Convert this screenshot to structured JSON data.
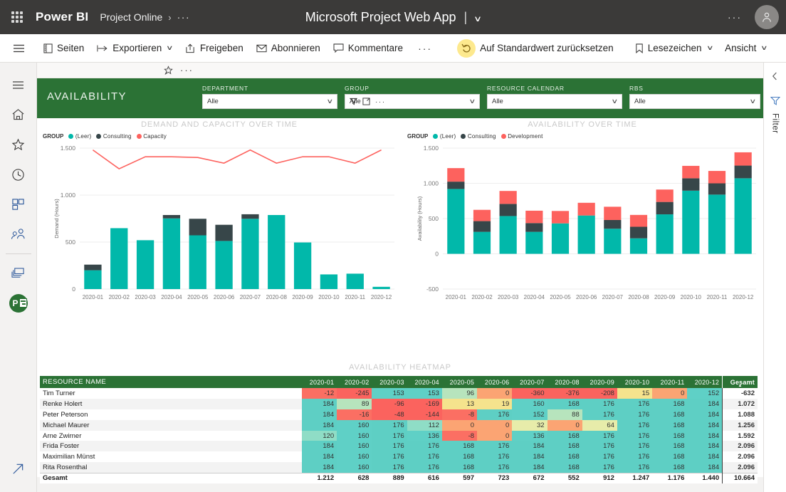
{
  "topbar": {
    "waffle_icon": "app-launcher-icon",
    "brand": "Power BI",
    "breadcrumb": "Project Online",
    "breadcrumb_sep": "›",
    "breadcrumb_more": "···",
    "app_title": "Microsoft Project Web App",
    "title_sep": "|",
    "title_caret": "∨",
    "more_options": "···",
    "avatar_icon": "user-avatar-icon"
  },
  "commandbar": {
    "menu_icon": "hamburger-menu-icon",
    "items": [
      {
        "label": "Seiten",
        "icon": "pages-icon",
        "caret": ""
      },
      {
        "label": "Exportieren",
        "icon": "export-icon",
        "caret": "∨"
      },
      {
        "label": "Freigeben",
        "icon": "share-icon",
        "caret": ""
      },
      {
        "label": "Abonnieren",
        "icon": "subscribe-mail-icon",
        "caret": ""
      },
      {
        "label": "Kommentare",
        "icon": "comments-icon",
        "caret": ""
      }
    ],
    "overflow": "···",
    "reset_label": "Auf Standardwert zurücksetzen",
    "reset_icon": "reset-undo-icon",
    "bookmarks_label": "Lesezeichen",
    "bookmarks_icon": "bookmark-icon",
    "bookmarks_caret": "∨",
    "view_label": "Ansicht",
    "view_caret": "∨"
  },
  "rail": {
    "items": [
      {
        "name": "nav-toggle",
        "icon": "hamburger-menu-icon"
      },
      {
        "name": "home",
        "icon": "home-icon"
      },
      {
        "name": "favorites",
        "icon": "star-icon"
      },
      {
        "name": "recent",
        "icon": "clock-icon"
      },
      {
        "name": "apps",
        "icon": "apps-grid-icon"
      },
      {
        "name": "shared-with-me",
        "icon": "people-icon"
      },
      {
        "name": "workspaces",
        "icon": "layers-icon"
      },
      {
        "name": "project-online-workspace",
        "icon": "project-app-icon"
      }
    ],
    "bottom": {
      "name": "get-data",
      "icon": "arrow-up-right-icon"
    }
  },
  "pagebar": {
    "pin_icon": "pin-star-icon",
    "more_icon": "···"
  },
  "report": {
    "banner_title": "AVAILABILITY",
    "slicers": [
      {
        "label": "DEPARTMENT",
        "value": "Alle",
        "caret": "∨"
      },
      {
        "label": "GROUP",
        "value": "Alle",
        "caret": "∨",
        "hover": {
          "filter_icon": "filter-icon",
          "focus_icon": "focus-mode-icon",
          "more": "···"
        }
      },
      {
        "label": "RESOURCE CALENDAR",
        "value": "Alle",
        "caret": "∨"
      },
      {
        "label": "RBS",
        "value": "Alle",
        "caret": "∨"
      }
    ],
    "heatmap_title": "AVAILABILITY HEATMAP"
  },
  "colors": {
    "teal": "#01b8aa",
    "dark": "#374649",
    "red": "#fd625e",
    "green_header": "#2b7235",
    "topbar": "#3b3a39",
    "reset_highlight": "#fde98e"
  },
  "chart_data": [
    {
      "type": "bar",
      "id": "demand-and-capacity-over-time",
      "title": "DEMAND AND CAPACITY OVER TIME",
      "legend_title": "GROUP",
      "legend_position": "top-left",
      "xlabel": "",
      "ylabel": "Demand (Hours)",
      "ylim": [
        0,
        1500
      ],
      "yticks": [
        0,
        500,
        1000,
        1500
      ],
      "ytick_labels": [
        "0",
        "500",
        "1.000",
        "1.500"
      ],
      "grid": true,
      "categories": [
        "2020-01",
        "2020-02",
        "2020-03",
        "2020-04",
        "2020-05",
        "2020-06",
        "2020-07",
        "2020-08",
        "2020-09",
        "2020-10",
        "2020-11",
        "2020-12"
      ],
      "series": [
        {
          "name": "(Leer)",
          "color": "#01b8aa",
          "kind": "bar",
          "values": [
            200,
            648,
            520,
            752,
            572,
            512,
            748,
            788,
            496,
            156,
            164,
            24
          ]
        },
        {
          "name": "Consulting",
          "color": "#374649",
          "kind": "bar",
          "values": [
            60,
            0,
            0,
            36,
            176,
            172,
            48,
            0,
            0,
            0,
            0,
            0
          ]
        },
        {
          "name": "Capacity",
          "color": "#fd625e",
          "kind": "line",
          "values": [
            1480,
            1280,
            1408,
            1408,
            1400,
            1340,
            1480,
            1340,
            1408,
            1408,
            1340,
            1480
          ]
        }
      ]
    },
    {
      "type": "bar",
      "id": "availability-over-time",
      "title": "AVAILABILITY OVER TIME",
      "legend_title": "GROUP",
      "legend_position": "top-left",
      "xlabel": "",
      "ylabel": "Availability (Hours)",
      "ylim": [
        -500,
        1500
      ],
      "yticks": [
        -500,
        0,
        500,
        1000,
        1500
      ],
      "ytick_labels": [
        "-500",
        "0",
        "500",
        "1.000",
        "1.500"
      ],
      "grid": true,
      "categories": [
        "2020-01",
        "2020-02",
        "2020-03",
        "2020-04",
        "2020-05",
        "2020-06",
        "2020-07",
        "2020-08",
        "2020-09",
        "2020-10",
        "2020-11",
        "2020-12"
      ],
      "series": [
        {
          "name": "(Leer)",
          "color": "#01b8aa",
          "kind": "bar",
          "values": [
            920,
            312,
            536,
            312,
            432,
            544,
            356,
            220,
            560,
            896,
            840,
            1072
          ]
        },
        {
          "name": "Consulting",
          "color": "#374649",
          "kind": "bar",
          "values": [
            104,
            152,
            172,
            124,
            0,
            0,
            124,
            164,
            176,
            176,
            160,
            180
          ]
        },
        {
          "name": "Development",
          "color": "#fd625e",
          "kind": "bar",
          "values": [
            192,
            160,
            184,
            176,
            176,
            180,
            188,
            168,
            176,
            176,
            176,
            188
          ]
        }
      ]
    },
    {
      "type": "table",
      "id": "availability-heatmap",
      "title": "AVAILABILITY HEATMAP",
      "columns": [
        "RESOURCE NAME",
        "2020-01",
        "2020-02",
        "2020-03",
        "2020-04",
        "2020-05",
        "2020-06",
        "2020-07",
        "2020-08",
        "2020-09",
        "2020-10",
        "2020-11",
        "2020-12",
        "Gesamt"
      ],
      "rows": [
        {
          "name": "Tim Turner",
          "values": [
            "-12",
            "-245",
            "153",
            "153",
            "96",
            "0",
            "-360",
            "-376",
            "-208",
            "15",
            "0",
            "152"
          ],
          "total": "-632"
        },
        {
          "name": "Renke Holert",
          "values": [
            "184",
            "89",
            "-96",
            "-169",
            "13",
            "19",
            "160",
            "168",
            "176",
            "176",
            "168",
            "184"
          ],
          "total": "1.072"
        },
        {
          "name": "Peter Peterson",
          "values": [
            "184",
            "-16",
            "-48",
            "-144",
            "-8",
            "176",
            "152",
            "88",
            "176",
            "176",
            "168",
            "184"
          ],
          "total": "1.088"
        },
        {
          "name": "Michael Maurer",
          "values": [
            "184",
            "160",
            "176",
            "112",
            "0",
            "0",
            "32",
            "0",
            "64",
            "176",
            "168",
            "184"
          ],
          "total": "1.256"
        },
        {
          "name": "Arne Zwirner",
          "values": [
            "120",
            "160",
            "176",
            "136",
            "-8",
            "0",
            "136",
            "168",
            "176",
            "176",
            "168",
            "184"
          ],
          "total": "1.592"
        },
        {
          "name": "Frida Foster",
          "values": [
            "184",
            "160",
            "176",
            "176",
            "168",
            "176",
            "184",
            "168",
            "176",
            "176",
            "168",
            "184"
          ],
          "total": "2.096"
        },
        {
          "name": "Maximilian Münst",
          "values": [
            "184",
            "160",
            "176",
            "176",
            "168",
            "176",
            "184",
            "168",
            "176",
            "176",
            "168",
            "184"
          ],
          "total": "2.096"
        },
        {
          "name": "Rita Rosenthal",
          "values": [
            "184",
            "160",
            "176",
            "176",
            "168",
            "176",
            "184",
            "168",
            "176",
            "176",
            "168",
            "184"
          ],
          "total": "2.096"
        }
      ],
      "total_row": {
        "name": "Gesamt",
        "values": [
          "1.212",
          "628",
          "889",
          "616",
          "597",
          "723",
          "672",
          "552",
          "912",
          "1.247",
          "1.176",
          "1.440"
        ],
        "total": "10.664"
      },
      "sort_marker": "▲"
    }
  ],
  "filterpane": {
    "expand_icon": "chevron-left-icon",
    "filter_icon": "filter-funnel-icon",
    "label": "Filter"
  }
}
